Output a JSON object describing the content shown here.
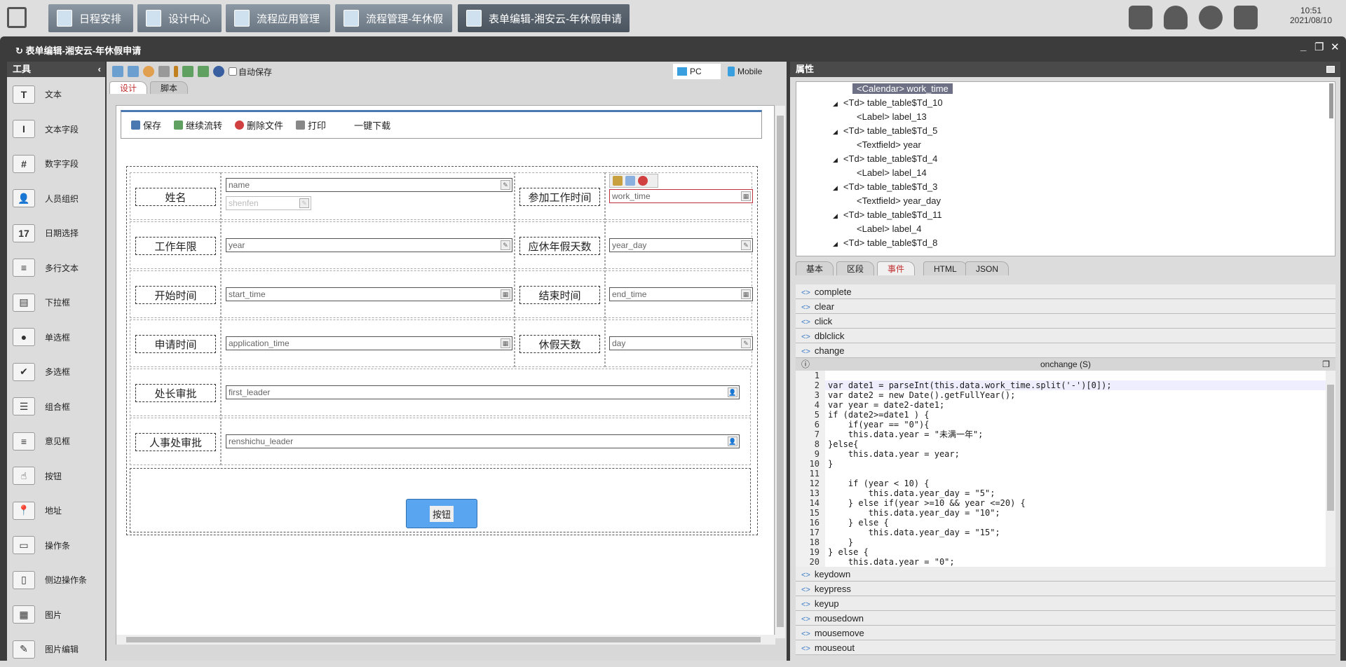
{
  "taskbar": {
    "tabs": [
      {
        "label": "日程安排"
      },
      {
        "label": "设计中心"
      },
      {
        "label": "流程应用管理"
      },
      {
        "label": "流程管理-年休假"
      },
      {
        "label": "表单编辑-湘安云-年休假申请"
      }
    ],
    "time": "10:51",
    "date": "2021/08/10"
  },
  "window": {
    "title": "表单编辑-湘安云-年休假申请"
  },
  "tools": {
    "title": "工具",
    "items": [
      {
        "label": "文本",
        "icon": "T"
      },
      {
        "label": "文本字段",
        "icon": "I"
      },
      {
        "label": "数字字段",
        "icon": "#"
      },
      {
        "label": "人员组织",
        "icon": "👤"
      },
      {
        "label": "日期选择",
        "icon": "17"
      },
      {
        "label": "多行文本",
        "icon": "≡"
      },
      {
        "label": "下拉框",
        "icon": "▤"
      },
      {
        "label": "单选框",
        "icon": "●"
      },
      {
        "label": "多选框",
        "icon": "✔"
      },
      {
        "label": "组合框",
        "icon": "☰"
      },
      {
        "label": "意见框",
        "icon": "≡"
      },
      {
        "label": "按钮",
        "icon": "☝"
      },
      {
        "label": "地址",
        "icon": "📍"
      },
      {
        "label": "操作条",
        "icon": "▭"
      },
      {
        "label": "侧边操作条",
        "icon": "▯"
      },
      {
        "label": "图片",
        "icon": "▦"
      },
      {
        "label": "图片编辑",
        "icon": "✎"
      }
    ]
  },
  "toolbar": {
    "autosave": "自动保存",
    "pc": "PC",
    "mobile": "Mobile",
    "tabs": [
      "设计",
      "脚本"
    ]
  },
  "actions": [
    "保存",
    "继续流转",
    "删除文件",
    "打印",
    "一键下载"
  ],
  "form": {
    "rows": [
      {
        "label1": "姓名",
        "field1": "name",
        "field1b": "shenfen",
        "label2": "参加工作时间",
        "field2": "work_time"
      },
      {
        "label1": "工作年限",
        "field1": "year",
        "label2": "应休年假天数",
        "field2": "year_day"
      },
      {
        "label1": "开始时间",
        "field1": "start_time",
        "label2": "结束时间",
        "field2": "end_time"
      },
      {
        "label1": "申请时间",
        "field1": "application_time",
        "label2": "休假天数",
        "field2": "day"
      },
      {
        "label1": "处长审批",
        "field1": "first_leader"
      },
      {
        "label1": "人事处审批",
        "field1": "renshichu_leader"
      }
    ],
    "button": "按钮"
  },
  "props": {
    "title": "属性",
    "tree": [
      "<Calendar> work_time",
      "<Td> table_table$Td_10",
      "<Label> label_13",
      "<Td> table_table$Td_5",
      "<Textfield> year",
      "<Td> table_table$Td_4",
      "<Label> label_14",
      "<Td> table_table$Td_3",
      "<Textfield> year_day",
      "<Td> table_table$Td_11",
      "<Label> label_4",
      "<Td> table_table$Td_8"
    ],
    "tabs": [
      "基本",
      "区段",
      "事件",
      "HTML",
      "JSON"
    ],
    "events_top": [
      "complete",
      "clear",
      "click",
      "dblclick",
      "change"
    ],
    "editor_title": "onchange (S)",
    "events_bottom": [
      "keydown",
      "keypress",
      "keyup",
      "mousedown",
      "mousemove",
      "mouseout"
    ]
  },
  "code": [
    "",
    "var date1 = parseInt(this.data.work_time.split('-')[0]);",
    "var date2 = new Date().getFullYear();",
    "var year = date2-date1;",
    "if (date2>=date1 ) {",
    "    if(year == \"0\"){",
    "    this.data.year = \"未满一年\";",
    "}else{",
    "    this.data.year = year;",
    "}",
    "",
    "    if (year < 10) {",
    "        this.data.year_day = \"5\";",
    "    } else if(year >=10 && year <=20) {",
    "        this.data.year_day = \"10\";",
    "    } else {",
    "        this.data.year_day = \"15\";",
    "    }",
    "} else {",
    "    this.data.year = \"0\";"
  ]
}
